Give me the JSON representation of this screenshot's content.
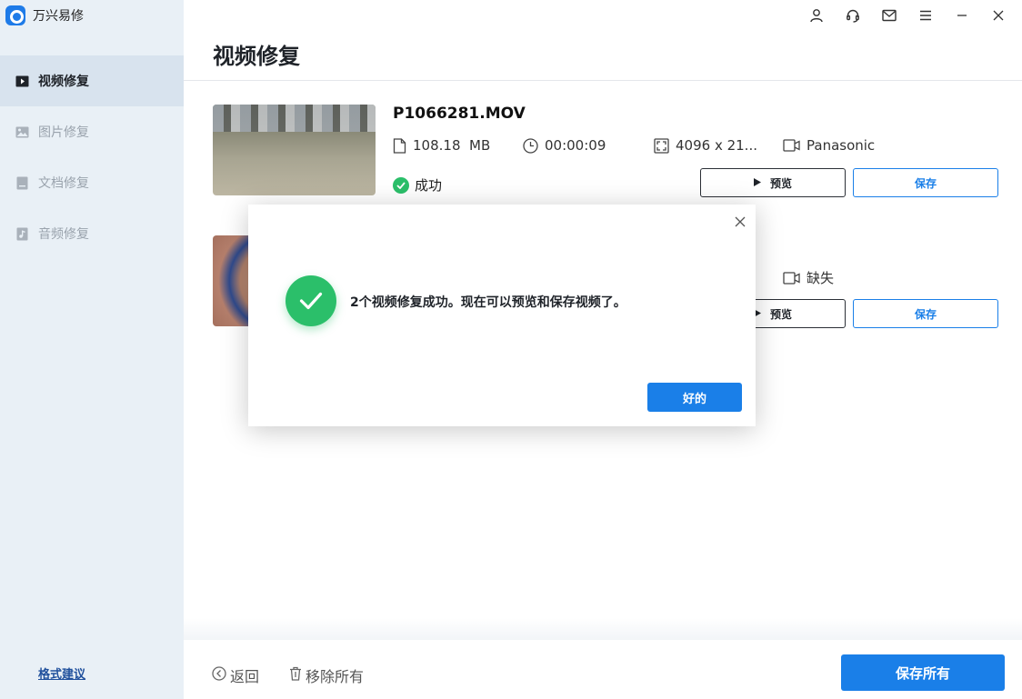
{
  "app": {
    "title": "万兴易修"
  },
  "sidebar": {
    "items": [
      {
        "label": "视频修复",
        "icon": "video-icon",
        "active": true
      },
      {
        "label": "图片修复",
        "icon": "image-icon",
        "active": false
      },
      {
        "label": "文档修复",
        "icon": "document-icon",
        "active": false
      },
      {
        "label": "音频修复",
        "icon": "audio-icon",
        "active": false
      }
    ],
    "feedback_label": "格式建议"
  },
  "header": {
    "icons": [
      "user-icon",
      "headset-icon",
      "mail-icon",
      "menu-icon",
      "minimize-icon",
      "close-icon"
    ]
  },
  "main": {
    "title": "视频修复",
    "videos": [
      {
        "name": "P1066281.MOV",
        "size": "108.18  MB",
        "duration": "00:00:09",
        "resolution": "4096 x 21...",
        "camera": "Panasonic",
        "status": "成功",
        "preview_label": "预览",
        "save_label": "保存"
      },
      {
        "camera": "缺失",
        "preview_label": "预览",
        "save_label": "保存"
      }
    ]
  },
  "footer": {
    "back_label": "返回",
    "remove_all_label": "移除所有",
    "save_all_label": "保存所有"
  },
  "dialog": {
    "message": "2个视频修复成功。现在可以预览和保存视频了。",
    "ok_label": "好的"
  },
  "colors": {
    "accent": "#1a7fe8",
    "success": "#2bbf6a",
    "sidebar_bg": "#e9f0f6"
  }
}
